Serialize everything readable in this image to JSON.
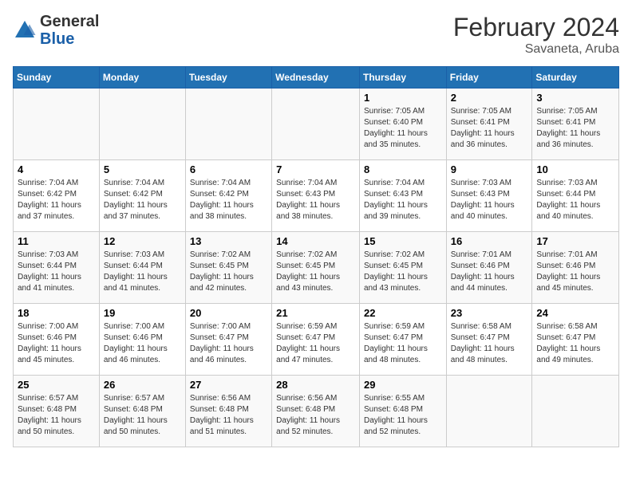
{
  "header": {
    "logo_general": "General",
    "logo_blue": "Blue",
    "month_title": "February 2024",
    "subtitle": "Savaneta, Aruba"
  },
  "weekdays": [
    "Sunday",
    "Monday",
    "Tuesday",
    "Wednesday",
    "Thursday",
    "Friday",
    "Saturday"
  ],
  "weeks": [
    [
      {
        "day": "",
        "info": ""
      },
      {
        "day": "",
        "info": ""
      },
      {
        "day": "",
        "info": ""
      },
      {
        "day": "",
        "info": ""
      },
      {
        "day": "1",
        "info": "Sunrise: 7:05 AM\nSunset: 6:40 PM\nDaylight: 11 hours and 35 minutes."
      },
      {
        "day": "2",
        "info": "Sunrise: 7:05 AM\nSunset: 6:41 PM\nDaylight: 11 hours and 36 minutes."
      },
      {
        "day": "3",
        "info": "Sunrise: 7:05 AM\nSunset: 6:41 PM\nDaylight: 11 hours and 36 minutes."
      }
    ],
    [
      {
        "day": "4",
        "info": "Sunrise: 7:04 AM\nSunset: 6:42 PM\nDaylight: 11 hours and 37 minutes."
      },
      {
        "day": "5",
        "info": "Sunrise: 7:04 AM\nSunset: 6:42 PM\nDaylight: 11 hours and 37 minutes."
      },
      {
        "day": "6",
        "info": "Sunrise: 7:04 AM\nSunset: 6:42 PM\nDaylight: 11 hours and 38 minutes."
      },
      {
        "day": "7",
        "info": "Sunrise: 7:04 AM\nSunset: 6:43 PM\nDaylight: 11 hours and 38 minutes."
      },
      {
        "day": "8",
        "info": "Sunrise: 7:04 AM\nSunset: 6:43 PM\nDaylight: 11 hours and 39 minutes."
      },
      {
        "day": "9",
        "info": "Sunrise: 7:03 AM\nSunset: 6:43 PM\nDaylight: 11 hours and 40 minutes."
      },
      {
        "day": "10",
        "info": "Sunrise: 7:03 AM\nSunset: 6:44 PM\nDaylight: 11 hours and 40 minutes."
      }
    ],
    [
      {
        "day": "11",
        "info": "Sunrise: 7:03 AM\nSunset: 6:44 PM\nDaylight: 11 hours and 41 minutes."
      },
      {
        "day": "12",
        "info": "Sunrise: 7:03 AM\nSunset: 6:44 PM\nDaylight: 11 hours and 41 minutes."
      },
      {
        "day": "13",
        "info": "Sunrise: 7:02 AM\nSunset: 6:45 PM\nDaylight: 11 hours and 42 minutes."
      },
      {
        "day": "14",
        "info": "Sunrise: 7:02 AM\nSunset: 6:45 PM\nDaylight: 11 hours and 43 minutes."
      },
      {
        "day": "15",
        "info": "Sunrise: 7:02 AM\nSunset: 6:45 PM\nDaylight: 11 hours and 43 minutes."
      },
      {
        "day": "16",
        "info": "Sunrise: 7:01 AM\nSunset: 6:46 PM\nDaylight: 11 hours and 44 minutes."
      },
      {
        "day": "17",
        "info": "Sunrise: 7:01 AM\nSunset: 6:46 PM\nDaylight: 11 hours and 45 minutes."
      }
    ],
    [
      {
        "day": "18",
        "info": "Sunrise: 7:00 AM\nSunset: 6:46 PM\nDaylight: 11 hours and 45 minutes."
      },
      {
        "day": "19",
        "info": "Sunrise: 7:00 AM\nSunset: 6:46 PM\nDaylight: 11 hours and 46 minutes."
      },
      {
        "day": "20",
        "info": "Sunrise: 7:00 AM\nSunset: 6:47 PM\nDaylight: 11 hours and 46 minutes."
      },
      {
        "day": "21",
        "info": "Sunrise: 6:59 AM\nSunset: 6:47 PM\nDaylight: 11 hours and 47 minutes."
      },
      {
        "day": "22",
        "info": "Sunrise: 6:59 AM\nSunset: 6:47 PM\nDaylight: 11 hours and 48 minutes."
      },
      {
        "day": "23",
        "info": "Sunrise: 6:58 AM\nSunset: 6:47 PM\nDaylight: 11 hours and 48 minutes."
      },
      {
        "day": "24",
        "info": "Sunrise: 6:58 AM\nSunset: 6:47 PM\nDaylight: 11 hours and 49 minutes."
      }
    ],
    [
      {
        "day": "25",
        "info": "Sunrise: 6:57 AM\nSunset: 6:48 PM\nDaylight: 11 hours and 50 minutes."
      },
      {
        "day": "26",
        "info": "Sunrise: 6:57 AM\nSunset: 6:48 PM\nDaylight: 11 hours and 50 minutes."
      },
      {
        "day": "27",
        "info": "Sunrise: 6:56 AM\nSunset: 6:48 PM\nDaylight: 11 hours and 51 minutes."
      },
      {
        "day": "28",
        "info": "Sunrise: 6:56 AM\nSunset: 6:48 PM\nDaylight: 11 hours and 52 minutes."
      },
      {
        "day": "29",
        "info": "Sunrise: 6:55 AM\nSunset: 6:48 PM\nDaylight: 11 hours and 52 minutes."
      },
      {
        "day": "",
        "info": ""
      },
      {
        "day": "",
        "info": ""
      }
    ]
  ]
}
